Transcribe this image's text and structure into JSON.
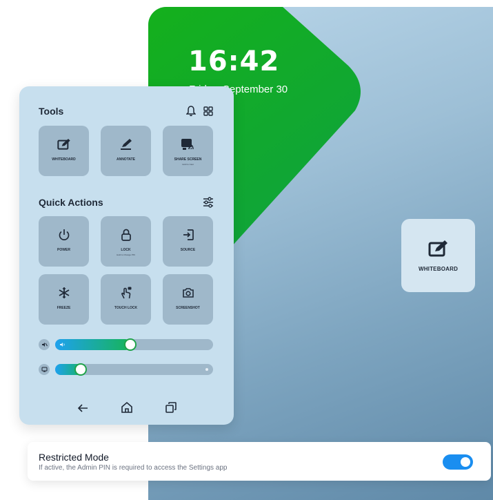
{
  "display": {
    "time": "16:42",
    "date": "Friday, September 30",
    "whiteboard_tile_label": "WHITEBOARD"
  },
  "panel": {
    "tools_title": "Tools",
    "quick_actions_title": "Quick Actions",
    "tools": [
      {
        "label": "WHITEBOARD",
        "icon": "whiteboard-icon"
      },
      {
        "label": "ANNOTATE",
        "icon": "annotate-icon"
      },
      {
        "label": "SHARE SCREEN",
        "sublabel": "Hold to Cast",
        "icon": "share-screen-icon"
      }
    ],
    "quick_actions": [
      {
        "label": "POWER",
        "icon": "power-icon"
      },
      {
        "label": "LOCK",
        "sublabel": "Hold to Change PIN",
        "icon": "lock-icon"
      },
      {
        "label": "SOURCE",
        "icon": "source-icon"
      },
      {
        "label": "FREEZE",
        "icon": "snowflake-icon"
      },
      {
        "label": "TOUCH LOCK",
        "icon": "touch-lock-icon"
      },
      {
        "label": "SCREENSHOT",
        "icon": "camera-icon"
      }
    ],
    "sliders": [
      {
        "name": "volume",
        "icon": "mute-icon",
        "value": 0.43
      },
      {
        "name": "brightness",
        "icon": "display-icon",
        "value": 0.16
      }
    ]
  },
  "restricted_mode": {
    "title": "Restricted Mode",
    "description": "If active, the Admin PIN is required to access the Settings app",
    "enabled": true
  },
  "colors": {
    "accent_green": "#13a833",
    "toggle_blue": "#1a8ef0",
    "panel_bg": "#c7dfee",
    "tile_bg": "#9fb8ca"
  }
}
